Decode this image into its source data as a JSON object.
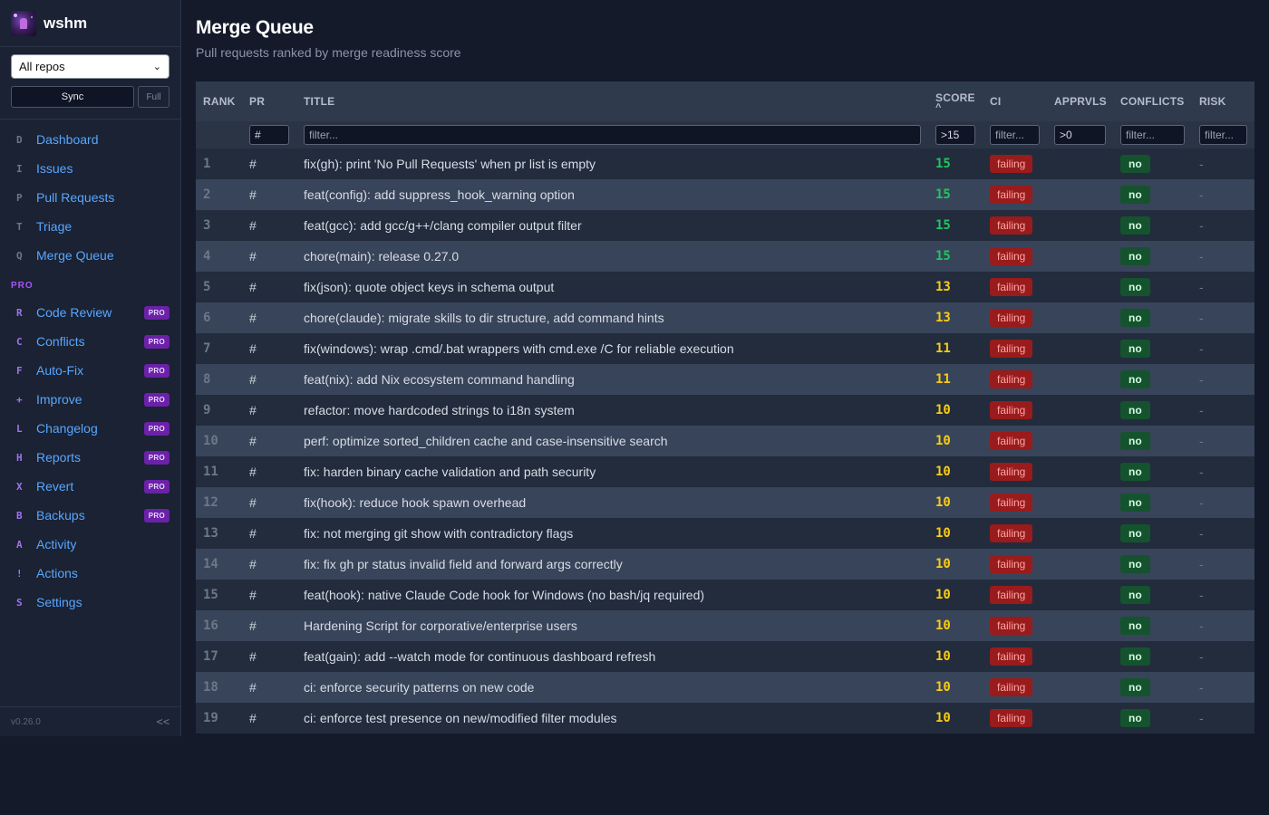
{
  "app": {
    "name": "wshm",
    "version": "v0.26.0",
    "collapse_label": "<<"
  },
  "sidebar": {
    "repo_select": "All repos",
    "sync_label": "Sync",
    "full_label": "Full",
    "section_pro": "PRO",
    "items": [
      {
        "key": "D",
        "label": "Dashboard",
        "pro": false
      },
      {
        "key": "I",
        "label": "Issues",
        "pro": false
      },
      {
        "key": "P",
        "label": "Pull Requests",
        "pro": false
      },
      {
        "key": "T",
        "label": "Triage",
        "pro": false
      },
      {
        "key": "Q",
        "label": "Merge Queue",
        "pro": false
      }
    ],
    "pro_items": [
      {
        "key": "R",
        "label": "Code Review",
        "badge": "PRO"
      },
      {
        "key": "C",
        "label": "Conflicts",
        "badge": "PRO"
      },
      {
        "key": "F",
        "label": "Auto-Fix",
        "badge": "PRO"
      },
      {
        "key": "+",
        "label": "Improve",
        "badge": "PRO"
      },
      {
        "key": "L",
        "label": "Changelog",
        "badge": "PRO"
      },
      {
        "key": "H",
        "label": "Reports",
        "badge": "PRO"
      },
      {
        "key": "X",
        "label": "Revert",
        "badge": "PRO"
      },
      {
        "key": "B",
        "label": "Backups",
        "badge": "PRO"
      },
      {
        "key": "A",
        "label": "Activity",
        "badge": ""
      },
      {
        "key": "!",
        "label": "Actions",
        "badge": ""
      },
      {
        "key": "S",
        "label": "Settings",
        "badge": ""
      }
    ]
  },
  "page": {
    "title": "Merge Queue",
    "subtitle": "Pull requests ranked by merge readiness score"
  },
  "table": {
    "columns": {
      "rank": "RANK",
      "pr": "PR",
      "title": "TITLE",
      "score": "SCORE",
      "score_sort": "^",
      "ci": "CI",
      "approvals": "APPRVLS",
      "conflicts": "CONFLICTS",
      "risk": "RISK"
    },
    "filters": {
      "pr": "#",
      "title": "filter...",
      "score": ">15",
      "ci": "filter...",
      "approvals": ">0",
      "conflicts": "filter...",
      "risk": "filter..."
    },
    "rows": [
      {
        "rank": "1",
        "pr": "#",
        "title": "fix(gh): print 'No Pull Requests' when pr list is empty",
        "score": "15",
        "ci": "failing",
        "approvals": "",
        "conflicts": "no",
        "risk": "-"
      },
      {
        "rank": "2",
        "pr": "#",
        "title": "feat(config): add suppress_hook_warning option",
        "score": "15",
        "ci": "failing",
        "approvals": "",
        "conflicts": "no",
        "risk": "-"
      },
      {
        "rank": "3",
        "pr": "#",
        "title": "feat(gcc): add gcc/g++/clang compiler output filter",
        "score": "15",
        "ci": "failing",
        "approvals": "",
        "conflicts": "no",
        "risk": "-"
      },
      {
        "rank": "4",
        "pr": "#",
        "title": "chore(main): release 0.27.0",
        "score": "15",
        "ci": "failing",
        "approvals": "",
        "conflicts": "no",
        "risk": "-"
      },
      {
        "rank": "5",
        "pr": "#",
        "title": "fix(json): quote object keys in schema output",
        "score": "13",
        "ci": "failing",
        "approvals": "",
        "conflicts": "no",
        "risk": "-"
      },
      {
        "rank": "6",
        "pr": "#",
        "title": "chore(claude): migrate skills to dir structure, add command hints",
        "score": "13",
        "ci": "failing",
        "approvals": "",
        "conflicts": "no",
        "risk": "-"
      },
      {
        "rank": "7",
        "pr": "#",
        "title": "fix(windows): wrap .cmd/.bat wrappers with cmd.exe /C for reliable execution",
        "score": "11",
        "ci": "failing",
        "approvals": "",
        "conflicts": "no",
        "risk": "-"
      },
      {
        "rank": "8",
        "pr": "#",
        "title": "feat(nix): add Nix ecosystem command handling",
        "score": "11",
        "ci": "failing",
        "approvals": "",
        "conflicts": "no",
        "risk": "-"
      },
      {
        "rank": "9",
        "pr": "#",
        "title": "refactor: move hardcoded strings to i18n system",
        "score": "10",
        "ci": "failing",
        "approvals": "",
        "conflicts": "no",
        "risk": "-"
      },
      {
        "rank": "10",
        "pr": "#",
        "title": "perf: optimize sorted_children cache and case-insensitive search",
        "score": "10",
        "ci": "failing",
        "approvals": "",
        "conflicts": "no",
        "risk": "-"
      },
      {
        "rank": "11",
        "pr": "#",
        "title": "fix: harden binary cache validation and path security",
        "score": "10",
        "ci": "failing",
        "approvals": "",
        "conflicts": "no",
        "risk": "-"
      },
      {
        "rank": "12",
        "pr": "#",
        "title": "fix(hook): reduce hook spawn overhead",
        "score": "10",
        "ci": "failing",
        "approvals": "",
        "conflicts": "no",
        "risk": "-"
      },
      {
        "rank": "13",
        "pr": "#",
        "title": "fix: not merging git show with contradictory flags",
        "score": "10",
        "ci": "failing",
        "approvals": "",
        "conflicts": "no",
        "risk": "-"
      },
      {
        "rank": "14",
        "pr": "#",
        "title": "fix: fix gh pr status invalid field and forward args correctly",
        "score": "10",
        "ci": "failing",
        "approvals": "",
        "conflicts": "no",
        "risk": "-"
      },
      {
        "rank": "15",
        "pr": "#",
        "title": "feat(hook): native Claude Code hook for Windows (no bash/jq required)",
        "score": "10",
        "ci": "failing",
        "approvals": "",
        "conflicts": "no",
        "risk": "-"
      },
      {
        "rank": "16",
        "pr": "#",
        "title": "Hardening Script for corporative/enterprise users",
        "score": "10",
        "ci": "failing",
        "approvals": "",
        "conflicts": "no",
        "risk": "-"
      },
      {
        "rank": "17",
        "pr": "#",
        "title": "feat(gain): add --watch mode for continuous dashboard refresh",
        "score": "10",
        "ci": "failing",
        "approvals": "",
        "conflicts": "no",
        "risk": "-"
      },
      {
        "rank": "18",
        "pr": "#",
        "title": "ci: enforce security patterns on new code",
        "score": "10",
        "ci": "failing",
        "approvals": "",
        "conflicts": "no",
        "risk": "-"
      },
      {
        "rank": "19",
        "pr": "#",
        "title": "ci: enforce test presence on new/modified filter modules",
        "score": "10",
        "ci": "failing",
        "approvals": "",
        "conflicts": "no",
        "risk": "-"
      }
    ]
  },
  "colors": {
    "background": "#141a2a",
    "sidebar": "#1a2233",
    "link": "#58a6ff",
    "pro_accent": "#a855f7",
    "score_high": "#22c55e",
    "score_mid": "#facc15",
    "failing_bg": "#991b1b",
    "no_bg": "#14532d"
  }
}
